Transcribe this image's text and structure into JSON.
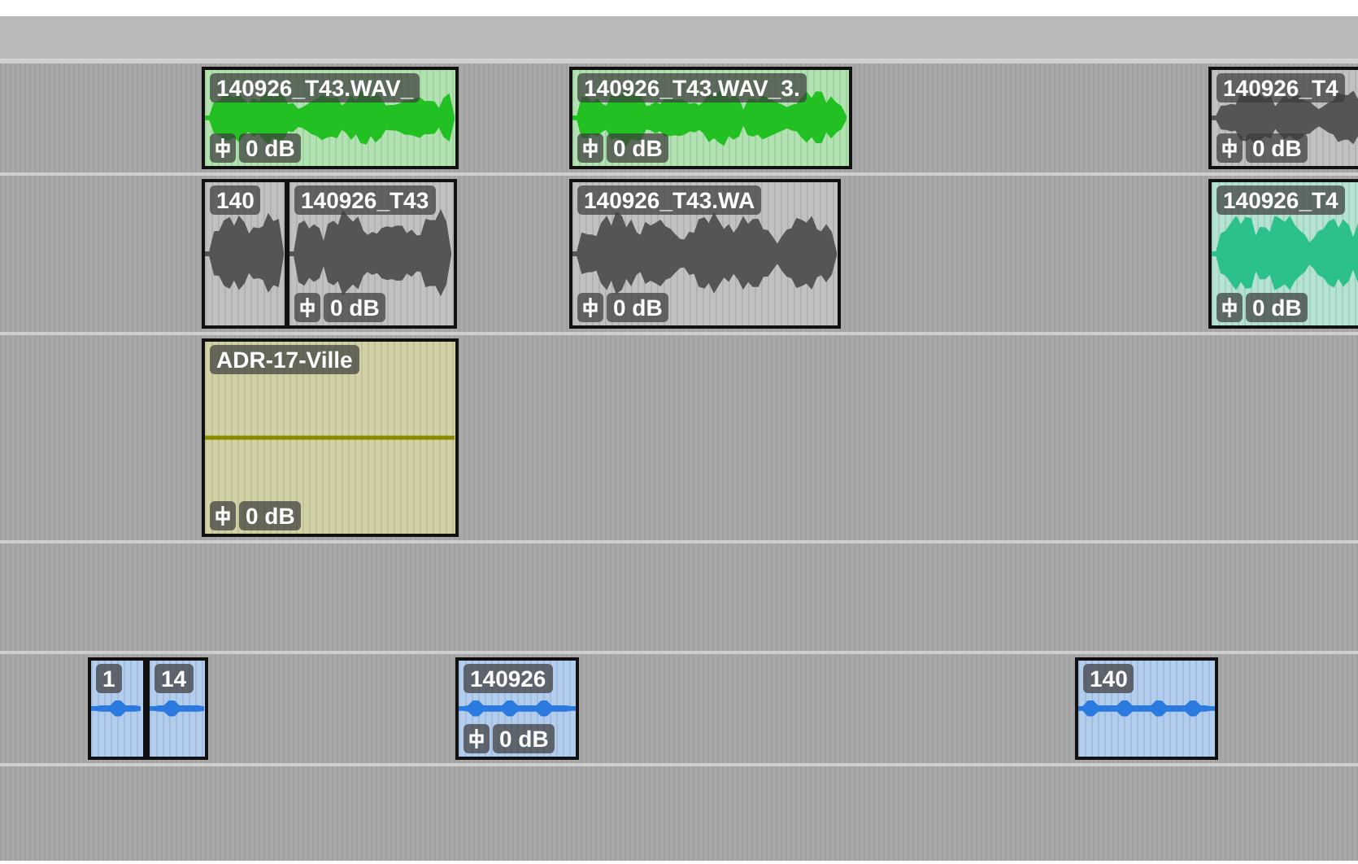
{
  "tracks": [
    {
      "clips": [
        {
          "name": "140926_T43.WAV_",
          "volume": "0 dB",
          "color": "#22c022",
          "kind": "loud"
        },
        {
          "name": "140926_T43.WAV_3.",
          "volume": "0 dB",
          "color": "#22c022",
          "kind": "loud"
        },
        {
          "name": "140926_T4",
          "volume": "0 dB",
          "color": "#555555",
          "kind": "loud"
        }
      ]
    },
    {
      "clips": [
        {
          "name": "140",
          "color": "#555555",
          "kind": "loud"
        },
        {
          "name": "140926_T43",
          "volume": "0 dB",
          "color": "#555555",
          "kind": "loud"
        },
        {
          "name": "140926_T43.WA",
          "volume": "0 dB",
          "color": "#555555",
          "kind": "loud"
        },
        {
          "name": "140926_T4",
          "volume": "0 dB",
          "color": "#2cc08a",
          "kind": "loud"
        }
      ]
    },
    {
      "clips": [
        {
          "name": "ADR-17-Ville",
          "volume": "0 dB",
          "color": "#8a8a00",
          "kind": "flat"
        }
      ]
    },
    {
      "clips": [
        {
          "name": "1",
          "color": "#2a7ae0",
          "kind": "sparse"
        },
        {
          "name": "14",
          "color": "#2a7ae0",
          "kind": "sparse"
        },
        {
          "name": "140926",
          "volume": "0 dB",
          "color": "#2a7ae0",
          "kind": "sparse"
        },
        {
          "name": "140",
          "color": "#2a7ae0",
          "kind": "sparse"
        }
      ]
    }
  ]
}
